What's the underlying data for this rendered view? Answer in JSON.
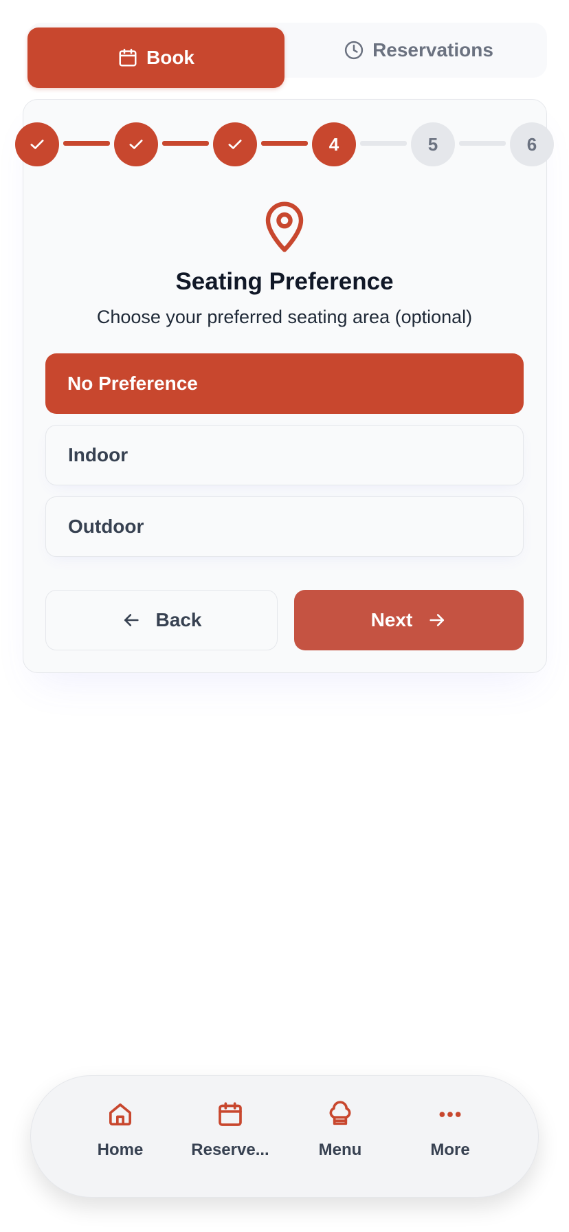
{
  "tabs": {
    "book_label": "Book",
    "reservations_label": "Reservations"
  },
  "stepper": {
    "current_step": 4,
    "total_steps": 6,
    "steps": [
      {
        "label": "",
        "state": "done"
      },
      {
        "label": "",
        "state": "done"
      },
      {
        "label": "",
        "state": "done"
      },
      {
        "label": "4",
        "state": "current"
      },
      {
        "label": "5",
        "state": "todo"
      },
      {
        "label": "6",
        "state": "todo"
      }
    ]
  },
  "step_content": {
    "icon": "map-pin-icon",
    "title": "Seating Preference",
    "subtitle": "Choose your preferred seating area (optional)"
  },
  "options": [
    {
      "label": "No Preference",
      "selected": true
    },
    {
      "label": "Indoor",
      "selected": false
    },
    {
      "label": "Outdoor",
      "selected": false
    }
  ],
  "buttons": {
    "back_label": "Back",
    "next_label": "Next"
  },
  "bottom_nav": [
    {
      "label": "Home",
      "icon": "home-icon"
    },
    {
      "label": "Reserve...",
      "icon": "calendar-icon"
    },
    {
      "label": "Menu",
      "icon": "chef-hat-icon"
    },
    {
      "label": "More",
      "icon": "more-dots-icon"
    }
  ],
  "colors": {
    "accent": "#c8472e",
    "next_button": "#c55342",
    "inactive_step": "#e5e7eb",
    "text_dark": "#111827",
    "text_muted": "#6b7280"
  }
}
